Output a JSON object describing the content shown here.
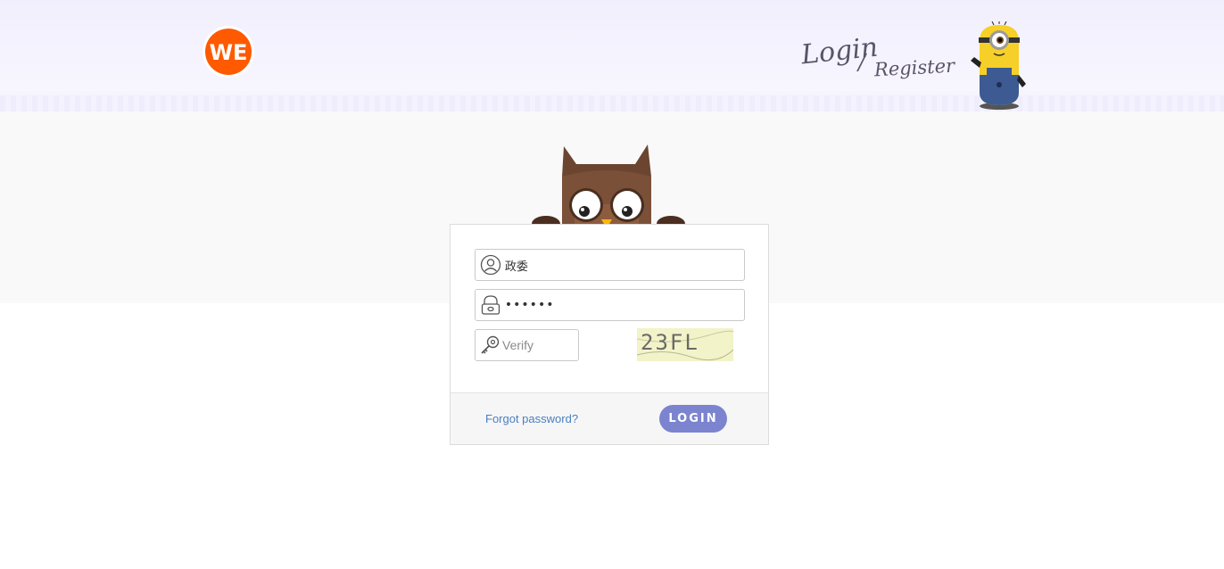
{
  "header": {
    "logo_text": "WE",
    "login_label": "Login",
    "separator": "/",
    "register_label": "Register"
  },
  "form": {
    "username": {
      "value": "政委",
      "icon": "user-icon"
    },
    "password": {
      "value": "••••••",
      "icon": "lock-icon"
    },
    "verify": {
      "placeholder": "Verify",
      "icon": "key-icon"
    },
    "captcha_text": "23FL"
  },
  "footer": {
    "forgot_label": "Forgot password?",
    "login_button": "LOGIN"
  },
  "colors": {
    "accent": "#7c84d0",
    "link": "#4a7fc0",
    "logo": "#ff5a00"
  }
}
